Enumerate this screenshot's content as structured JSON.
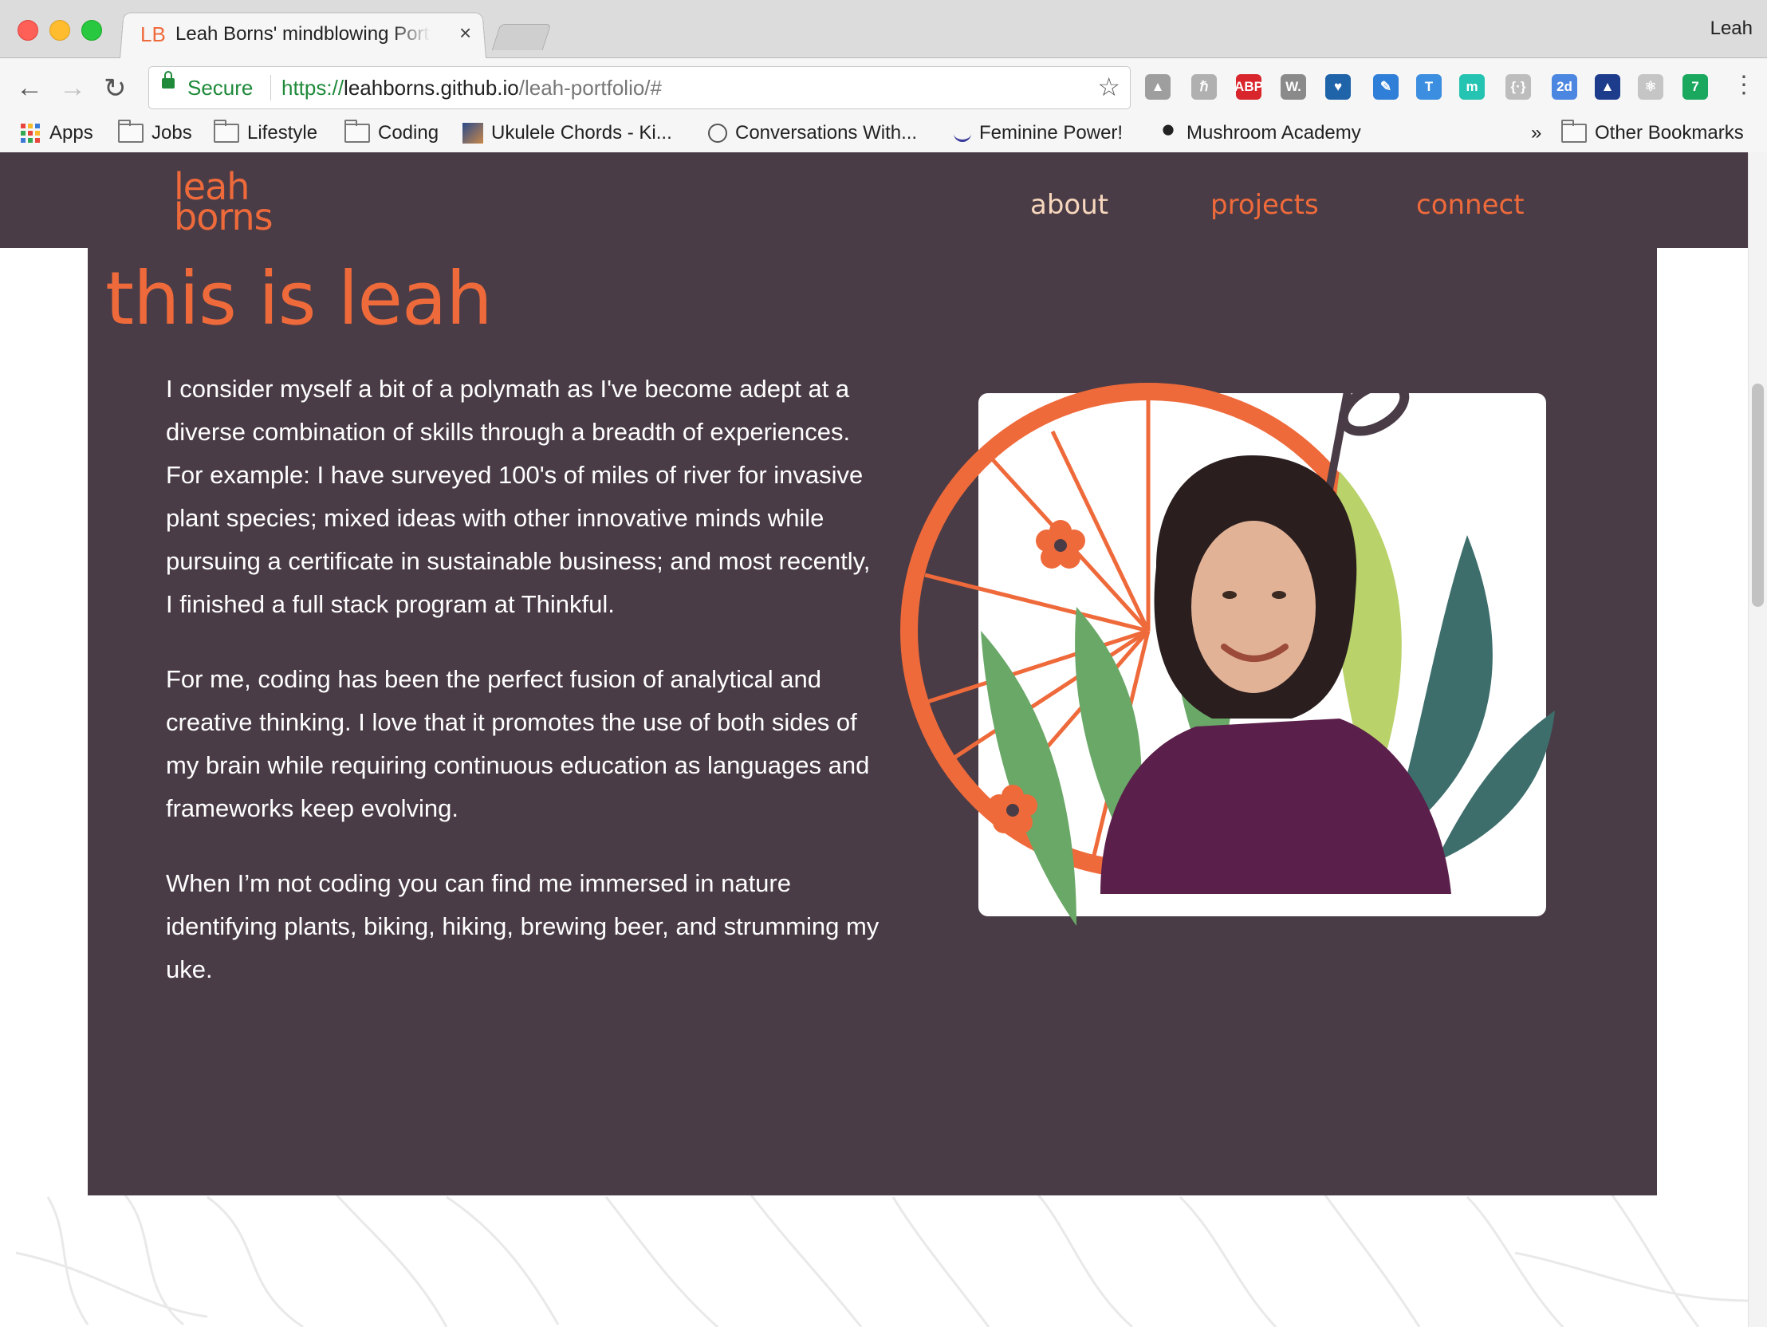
{
  "browser": {
    "profile_name": "Leah",
    "tab": {
      "favicon": "LB",
      "title": "Leah Borns' mindblowing Portfolio",
      "close": "×"
    },
    "nav": {
      "back": "←",
      "forward": "→",
      "reload": "↻"
    },
    "omnibox": {
      "secure_label": "Secure",
      "url_scheme": "https://",
      "url_host": "leahborns.github.io",
      "url_path": "/leah-portfolio/#",
      "bookmark_star": "☆"
    },
    "extensions": [
      {
        "name": "drive-icon",
        "label": "▲",
        "color": "#9e9e9e"
      },
      {
        "name": "hacker-news-icon",
        "label": "ℏ",
        "color": "#b0b0b0"
      },
      {
        "name": "adblock-plus-icon",
        "label": "ABP",
        "color": "#d8262c"
      },
      {
        "name": "wappalyzer-icon",
        "label": "W.",
        "color": "#8a8a8a"
      },
      {
        "name": "vimeo-heart-icon",
        "label": "♥",
        "color": "#1f63a8"
      },
      {
        "name": "eyedropper-icon",
        "label": "✎",
        "color": "#2f7fd8"
      },
      {
        "name": "typography-icon",
        "label": "T",
        "color": "#3c8ee0"
      },
      {
        "name": "momentum-icon",
        "label": "m",
        "color": "#25c3b1"
      },
      {
        "name": "json-viewer-icon",
        "label": "{·}",
        "color": "#bdbdbd"
      },
      {
        "name": "calendar-2d-icon",
        "label": "2d",
        "color": "#4b86e0"
      },
      {
        "name": "axe-icon",
        "label": "▲",
        "color": "#1d3c8c"
      },
      {
        "name": "react-devtools-icon",
        "label": "⚛",
        "color": "#c5c5c5"
      },
      {
        "name": "grammarly-icon",
        "label": "7",
        "color": "#1aa85f"
      }
    ],
    "menu": "⋮"
  },
  "bookmarks": {
    "apps": "Apps",
    "items": [
      {
        "label": "Jobs",
        "type": "folder"
      },
      {
        "label": "Lifestyle",
        "type": "folder"
      },
      {
        "label": "Coding",
        "type": "folder"
      },
      {
        "label": "Ukulele Chords - Ki...",
        "type": "site"
      },
      {
        "label": "Conversations With...",
        "type": "site"
      },
      {
        "label": "Feminine Power!",
        "type": "site"
      },
      {
        "label": "Mushroom Academy",
        "type": "site"
      }
    ],
    "overflow": "»",
    "other": "Other Bookmarks"
  },
  "site": {
    "logo_line1": "leah",
    "logo_line2": "borns",
    "nav": {
      "about": "about",
      "projects": "projects",
      "connect": "connect"
    },
    "about": {
      "heading": "this is leah",
      "paragraphs": [
        "I consider myself a bit of a polymath as I've become adept at a diverse combination of skills through a breadth of experiences. For example: I have surveyed 100's of miles of river for invasive plant species; mixed ideas with other innovative minds while pursuing a certificate in sustainable business; and most recently, I finished a full stack program at Thinkful.",
        "For me, coding has been the perfect fusion of analytical and creative thinking. I love that it promotes the use of both sides of my brain while requiring continuous education as languages and frameworks keep evolving.",
        "When I’m not coding you can find me immersed in nature identifying plants, biking, hiking, brewing beer, and strumming my uke."
      ]
    },
    "colors": {
      "panel": "#4a3c46",
      "accent": "#ef6a3b",
      "nav_active": "#f7d7bd",
      "leaf_green": "#6aa868",
      "leaf_lime": "#b9d26a",
      "leaf_teal": "#3d6e6c",
      "sweater": "#5a1f4a"
    }
  }
}
